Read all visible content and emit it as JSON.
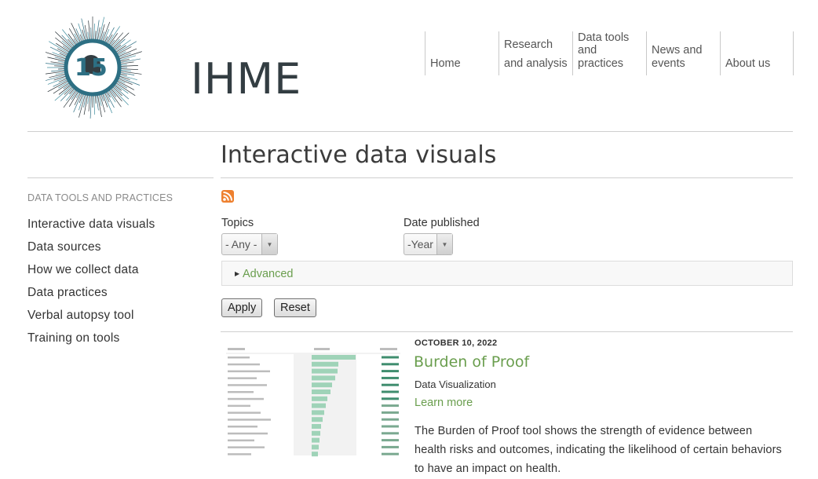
{
  "header": {
    "logo_number": "15",
    "logo_text": "IHME",
    "nav": [
      {
        "label": "Home"
      },
      {
        "label": "Research and analysis",
        "lines": [
          "Research",
          "and analysis"
        ]
      },
      {
        "label": "Data tools and practices",
        "lines": [
          "Data tools",
          "and",
          "practices"
        ]
      },
      {
        "label": "News and events",
        "lines": [
          "News and",
          "events"
        ]
      },
      {
        "label": "About us"
      }
    ]
  },
  "page": {
    "title": "Interactive data visuals"
  },
  "sidebar": {
    "heading": "DATA TOOLS AND PRACTICES",
    "items": [
      {
        "label": "Interactive data visuals"
      },
      {
        "label": "Data sources"
      },
      {
        "label": "How we collect data"
      },
      {
        "label": "Data practices"
      },
      {
        "label": "Verbal autopsy tool"
      },
      {
        "label": "Training on tools"
      }
    ]
  },
  "filters": {
    "topics_label": "Topics",
    "topics_value": "- Any -",
    "date_label": "Date published",
    "date_value": "-Year",
    "advanced_label": "Advanced",
    "apply_label": "Apply",
    "reset_label": "Reset"
  },
  "result": {
    "date": "OCTOBER 10, 2022",
    "title": "Burden of Proof",
    "type": "Data Visualization",
    "learn_more": "Learn more",
    "description": "The Burden of Proof tool shows the strength of evidence between health risks and outcomes, indicating the likelihood of certain behaviors to have an impact on health."
  },
  "colors": {
    "link_green": "#6a9e4e",
    "rss_orange": "#ee802f",
    "logo_teal": "#2d6f83",
    "logo_dark": "#333d42"
  }
}
